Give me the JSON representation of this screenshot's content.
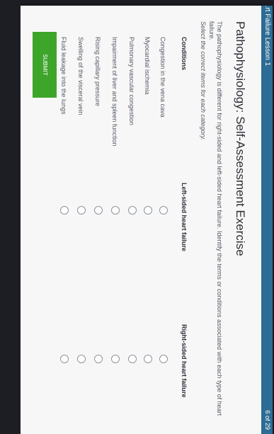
{
  "header": {
    "course_title": "...rt Failure Lesson 1",
    "page_indicator": "6 of 29"
  },
  "page_title": "Pathophysiology: Self-Assessment Exercise",
  "intro_text": "The pathophysiology is different for right-sided and left-sided heart failure. Identify the terms or conditions associated with each type of heart failure.",
  "instruction": "Select the correct items for each category.",
  "table": {
    "headers": {
      "conditions": "Conditions",
      "left": "Left-sided heart failure",
      "right": "Right-sided heart failure"
    },
    "rows": [
      {
        "label": "Congestion in the vena cava"
      },
      {
        "label": "Myocardial ischemia"
      },
      {
        "label": "Pulmonary vascular congestion"
      },
      {
        "label": "Impairment of liver and spleen function"
      },
      {
        "label": "Rising capillary pressure"
      },
      {
        "label": "Swelling of the visceral vein"
      },
      {
        "label": "Fluid leakage into the lungs"
      }
    ]
  },
  "submit_label": "SUBMIT",
  "colors": {
    "header_bar": "#2d6c94",
    "submit_button": "#3ea52b"
  }
}
